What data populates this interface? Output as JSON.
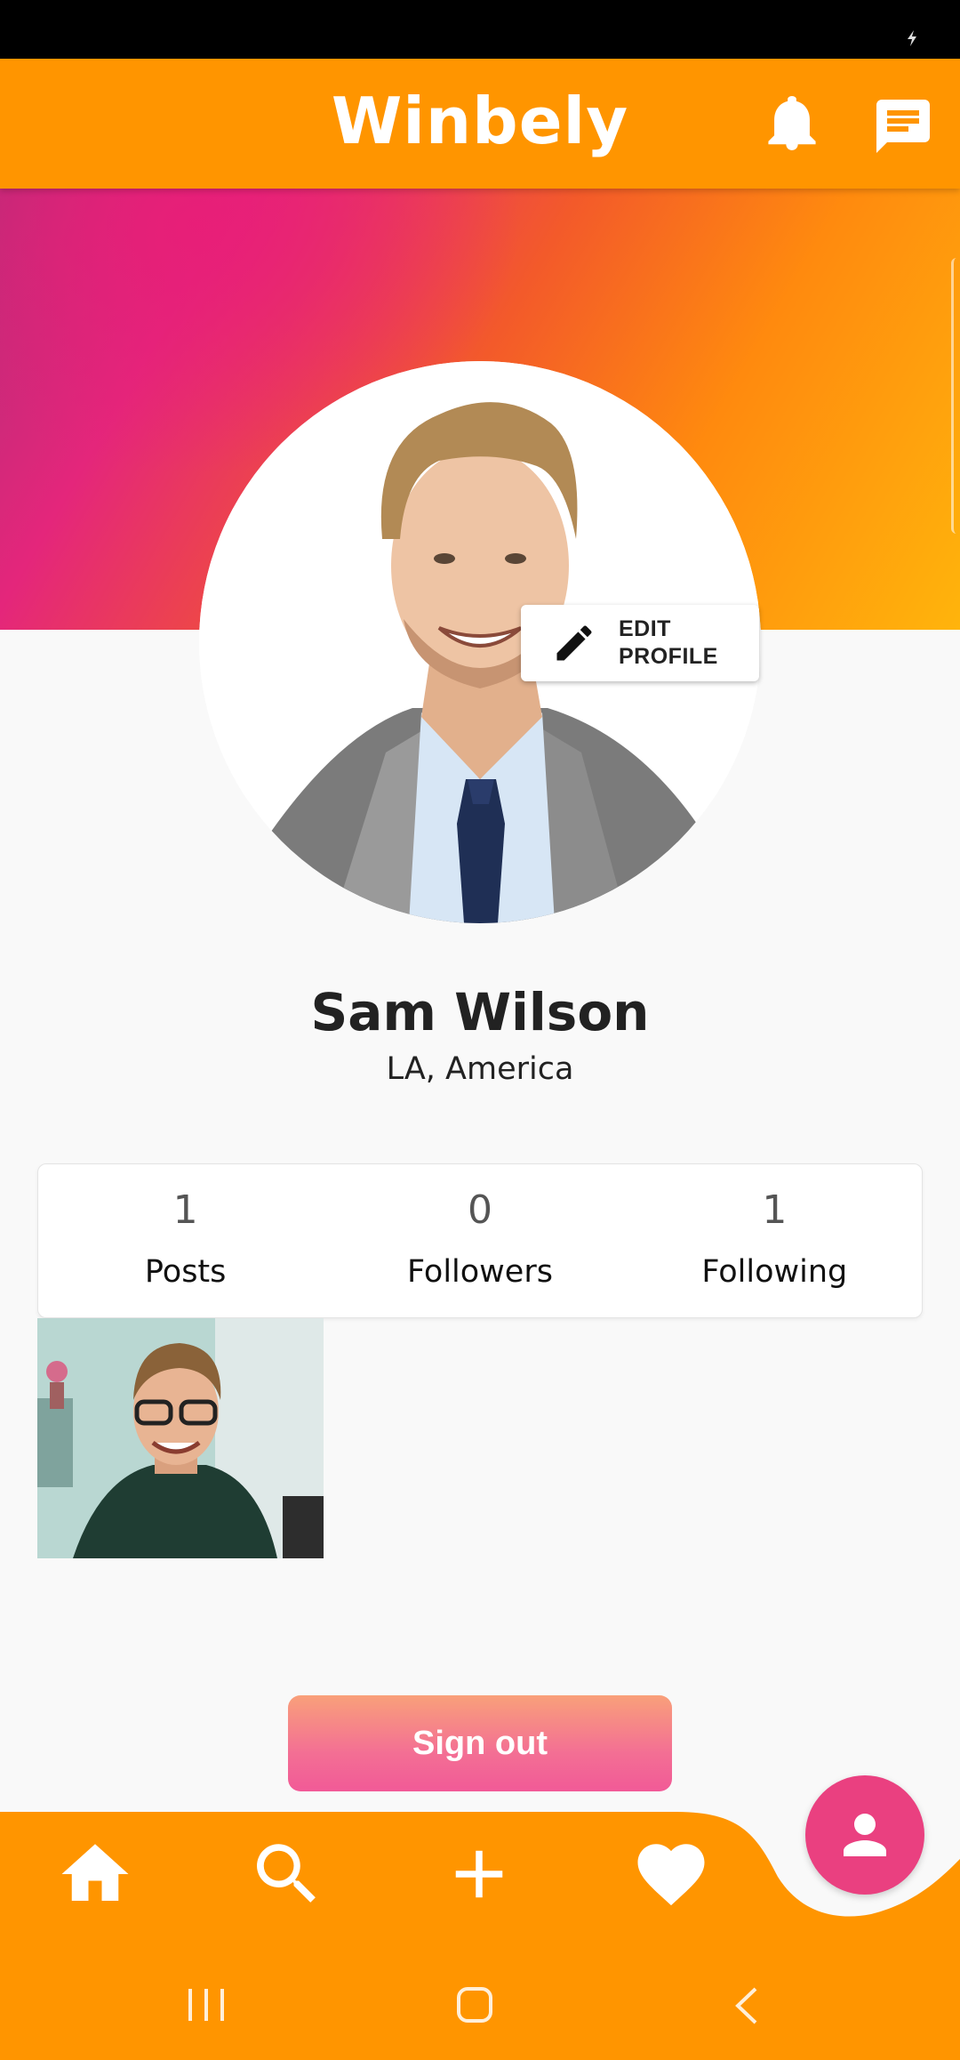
{
  "app": {
    "title": "Winbely",
    "accent_color": "#ff9500",
    "icons": {
      "notifications": "bell-icon",
      "messages": "chat-icon"
    }
  },
  "profile": {
    "name": "Sam Wilson",
    "location": "LA, America",
    "edit_label": "EDIT PROFILE",
    "edit_icon": "pencil-icon"
  },
  "stats": [
    {
      "value": "1",
      "label": "Posts"
    },
    {
      "value": "0",
      "label": "Followers"
    },
    {
      "value": "1",
      "label": "Following"
    }
  ],
  "sign_out": {
    "label": "Sign out"
  },
  "bottom_nav": {
    "items": [
      "home-icon",
      "search-icon",
      "add-icon",
      "heart-icon"
    ],
    "active_fab": "profile-icon",
    "fab_color": "#ea4080"
  },
  "system_nav": [
    "recent-apps-icon",
    "home-button-icon",
    "back-icon"
  ]
}
